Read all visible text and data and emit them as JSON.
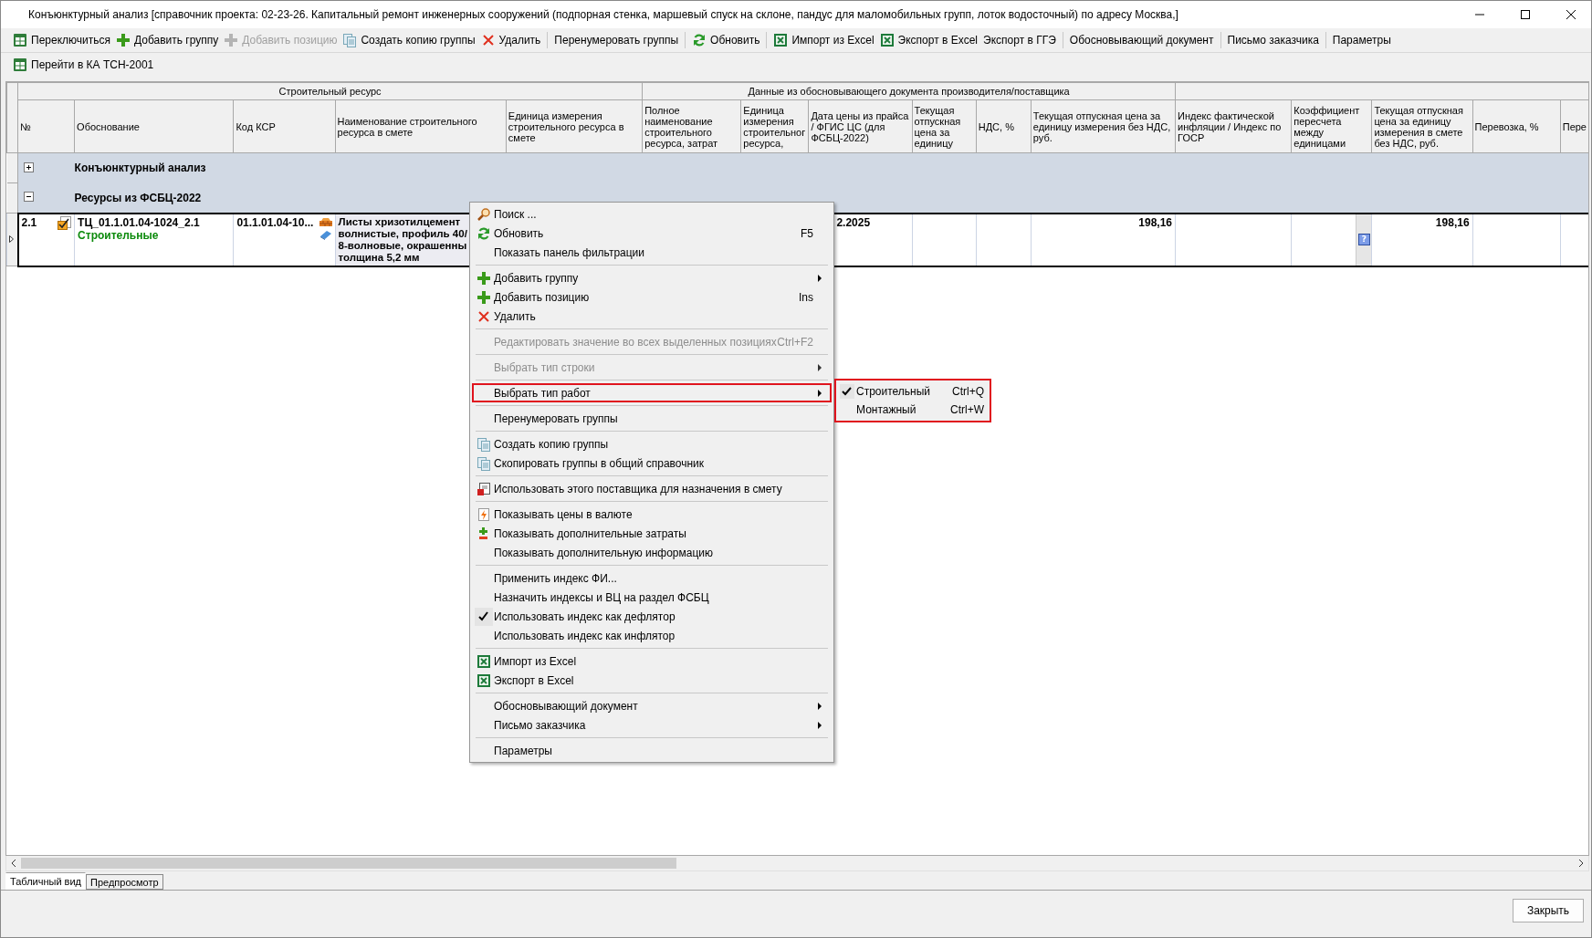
{
  "window": {
    "title": "Конъюнктурный анализ [справочник проекта: 02-23-26. Капитальный ремонт инженерных сооружений (подпорная стенка, маршевый спуск на склоне, пандус для маломобильных групп, лоток водосточный) по адресу Москва,]"
  },
  "toolbar": {
    "rows": [
      [
        [
          {
            "label": "Переключиться",
            "kind": "switch",
            "disabled": false
          },
          {
            "label": "Добавить группу",
            "kind": "add",
            "disabled": false
          },
          {
            "label": "Добавить позицию",
            "kind": "add",
            "disabled": true
          },
          {
            "label": "Создать копию группы",
            "kind": "copy",
            "disabled": false
          },
          {
            "label": "Удалить",
            "kind": "delete",
            "disabled": false
          }
        ],
        [
          {
            "label": "Перенумеровать группы",
            "kind": "plain",
            "disabled": false
          }
        ],
        [
          {
            "label": "Обновить",
            "kind": "refresh",
            "disabled": false
          }
        ],
        [
          {
            "label": "Импорт из Excel",
            "kind": "excel",
            "disabled": false
          },
          {
            "label": "Экспорт в Excel",
            "kind": "excel",
            "disabled": false
          },
          {
            "label": "Экспорт в ГГЭ",
            "kind": "plain",
            "disabled": false
          }
        ],
        [
          {
            "label": "Обосновывающий документ",
            "kind": "plain",
            "disabled": false
          }
        ],
        [
          {
            "label": "Письмо заказчика",
            "kind": "plain",
            "disabled": false
          }
        ],
        [
          {
            "label": "Параметры",
            "kind": "plain",
            "disabled": false
          }
        ]
      ],
      [
        [
          {
            "label": "Перейти в КА ТСН-2001",
            "kind": "switch",
            "disabled": false
          }
        ]
      ]
    ]
  },
  "table": {
    "column_groups": [
      {
        "label": "Строительный ресурс",
        "columns": [
          "№",
          "Обоснование",
          "Код КСР",
          "Наименование строительного ресурса в смете",
          "Единица измерения строительного ресурса в смете"
        ]
      },
      {
        "label": "Данные из обосновывающего документа производителя/поставщика",
        "columns": [
          "Полное наименование строительного ресурса, затрат",
          "Единица измерения строительног ресурса,",
          "Дата цены из прайса / ФГИС ЦС (для ФСБЦ-2022)",
          "Текущая отпускная цена за единицу",
          "НДС, %",
          "Текущая отпускная цена за единицу измерения без НДС, руб."
        ]
      },
      {
        "columns": [
          "Индекс фактической инфляции /  Индекс по ГОСР",
          "Коэффициент пересчета между единицами",
          "Текущая отпускная цена за единицу измерения в смете без НДС, руб.",
          "Перевозка, %",
          "Пере"
        ]
      }
    ],
    "rows": [
      {
        "kind": "group",
        "label": "Конъюнктурный анализ",
        "expanded": false
      },
      {
        "kind": "group",
        "label": "Ресурсы из ФСБЦ-2022",
        "expanded": true
      },
      {
        "kind": "resource",
        "selected": true,
        "number": "2.1",
        "basis": "ТЦ_01.1.01.04-1024_2.1",
        "work_type": "Строительные",
        "ksr_code": "01.1.01.04-10...",
        "name": "Листы хризотилцемент\nволнистые, профиль 40/\n8-волновые, окрашенны\nтолщина 5,2 мм",
        "price_date": "2.2025",
        "price_no_vat": "198,16",
        "coefficient_button": "?",
        "estimate_price": "198,16"
      }
    ]
  },
  "context_menu": {
    "items": [
      {
        "kind": "search",
        "label": "Поиск ...",
        "disabled": false,
        "checked": false,
        "submenu": false,
        "highlighted": false
      },
      {
        "kind": "refresh",
        "label": "Обновить",
        "shortcut": "F5",
        "disabled": false,
        "checked": false,
        "submenu": false,
        "highlighted": false
      },
      {
        "kind": "plain",
        "label": "Показать панель фильтрации",
        "disabled": false,
        "checked": false,
        "submenu": false,
        "highlighted": false
      },
      {
        "kind": "separator"
      },
      {
        "kind": "add",
        "label": "Добавить группу",
        "disabled": false,
        "checked": false,
        "submenu": true,
        "highlighted": false
      },
      {
        "kind": "add",
        "label": "Добавить позицию",
        "shortcut": "Ins",
        "disabled": false,
        "checked": false,
        "submenu": false,
        "highlighted": false
      },
      {
        "kind": "delete",
        "label": "Удалить",
        "disabled": false,
        "checked": false,
        "submenu": false,
        "highlighted": false
      },
      {
        "kind": "separator"
      },
      {
        "kind": "plain",
        "label": "Редактировать значение во всех выделенных позициях",
        "shortcut": "Ctrl+F2",
        "disabled": true,
        "checked": false,
        "submenu": false,
        "highlighted": false
      },
      {
        "kind": "separator"
      },
      {
        "kind": "plain",
        "label": "Выбрать тип строки",
        "disabled": true,
        "checked": false,
        "submenu": true,
        "highlighted": false
      },
      {
        "kind": "separator"
      },
      {
        "kind": "plain",
        "label": "Выбрать тип работ",
        "disabled": false,
        "checked": false,
        "submenu": true,
        "highlighted": true
      },
      {
        "kind": "separator"
      },
      {
        "kind": "plain",
        "label": "Перенумеровать группы",
        "disabled": false,
        "checked": false,
        "submenu": false,
        "highlighted": false
      },
      {
        "kind": "separator"
      },
      {
        "kind": "copy",
        "label": "Создать копию группы",
        "disabled": false,
        "checked": false,
        "submenu": false,
        "highlighted": false
      },
      {
        "kind": "copy",
        "label": "Скопировать группы в общий справочник",
        "disabled": false,
        "checked": false,
        "submenu": false,
        "highlighted": false
      },
      {
        "kind": "separator"
      },
      {
        "kind": "assign",
        "label": "Использовать этого поставщика для назначения в смету",
        "disabled": false,
        "checked": false,
        "submenu": false,
        "highlighted": false
      },
      {
        "kind": "separator"
      },
      {
        "kind": "currency",
        "label": "Показывать цены в валюте",
        "disabled": false,
        "checked": false,
        "submenu": false,
        "highlighted": false
      },
      {
        "kind": "costs",
        "label": "Показывать дополнительные затраты",
        "disabled": false,
        "checked": false,
        "submenu": false,
        "highlighted": false
      },
      {
        "kind": "plain",
        "label": "Показывать дополнительную информацию",
        "disabled": false,
        "checked": false,
        "submenu": false,
        "highlighted": false
      },
      {
        "kind": "separator"
      },
      {
        "kind": "plain",
        "label": "Применить индекс ФИ...",
        "disabled": false,
        "checked": false,
        "submenu": false,
        "highlighted": false
      },
      {
        "kind": "plain",
        "label": "Назначить индексы и ВЦ на раздел ФСБЦ",
        "disabled": false,
        "checked": false,
        "submenu": false,
        "highlighted": false
      },
      {
        "kind": "plain",
        "label": "Использовать индекс как дефлятор",
        "disabled": false,
        "checked": true,
        "submenu": false,
        "highlighted": false
      },
      {
        "kind": "plain",
        "label": "Использовать индекс как инфлятор",
        "disabled": false,
        "checked": false,
        "submenu": false,
        "highlighted": false
      },
      {
        "kind": "separator"
      },
      {
        "kind": "excel",
        "label": "Импорт из Excel",
        "disabled": false,
        "checked": false,
        "submenu": false,
        "highlighted": false
      },
      {
        "kind": "excel",
        "label": "Экспорт в Excel",
        "disabled": false,
        "checked": false,
        "submenu": false,
        "highlighted": false
      },
      {
        "kind": "separator"
      },
      {
        "kind": "plain",
        "label": "Обосновывающий документ",
        "disabled": false,
        "checked": false,
        "submenu": true,
        "highlighted": false
      },
      {
        "kind": "plain",
        "label": "Письмо заказчика",
        "disabled": false,
        "checked": false,
        "submenu": true,
        "highlighted": false
      },
      {
        "kind": "separator"
      },
      {
        "kind": "plain",
        "label": "Параметры",
        "disabled": false,
        "checked": false,
        "submenu": false,
        "highlighted": false
      }
    ]
  },
  "submenu": {
    "highlighted": true,
    "items": [
      {
        "label": "Строительный",
        "shortcut": "Ctrl+Q",
        "checked": true
      },
      {
        "label": "Монтажный",
        "shortcut": "Ctrl+W",
        "checked": false
      }
    ]
  },
  "tabs": [
    {
      "label": "Табличный вид",
      "selected": true
    },
    {
      "label": "Предпросмотр",
      "selected": false
    }
  ],
  "footer": {
    "close_button": "Закрыть"
  }
}
